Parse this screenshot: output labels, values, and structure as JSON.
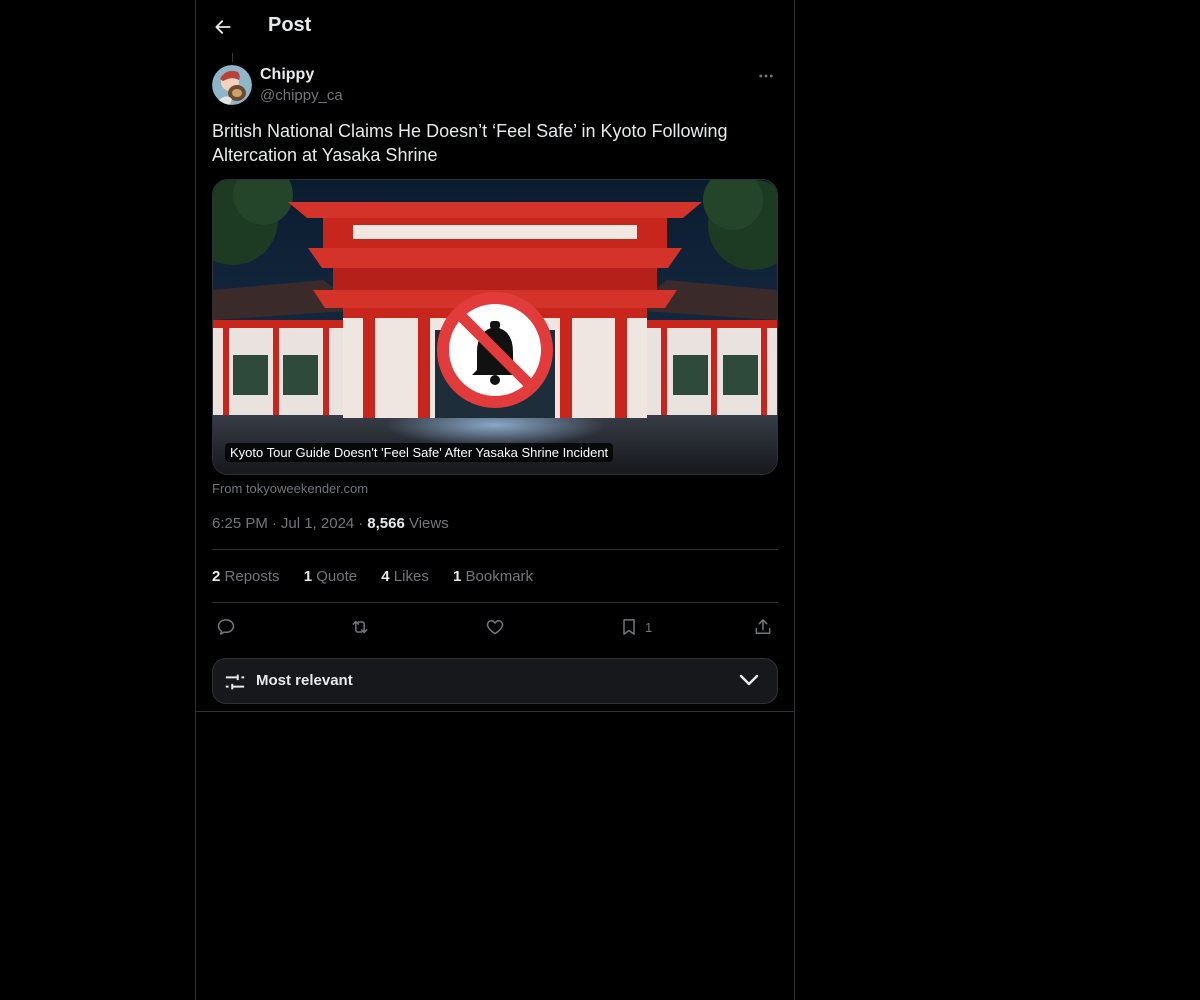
{
  "header": {
    "title": "Post"
  },
  "author": {
    "display_name": "Chippy",
    "handle": "@chippy_ca"
  },
  "post": {
    "text": "British National Claims He Doesn’t ‘Feel Safe’ in Kyoto Following Altercation at Yasaka Shrine"
  },
  "card": {
    "caption": "Kyoto Tour Guide Doesn't 'Feel Safe' After Yasaka Shrine Incident",
    "source": "From tokyoweekender.com"
  },
  "meta": {
    "time": "6:25 PM",
    "separator": "·",
    "date": "Jul 1, 2024",
    "views_count": "8,566",
    "views_label": "Views"
  },
  "stats": {
    "reposts": {
      "count": "2",
      "label": "Reposts"
    },
    "quotes": {
      "count": "1",
      "label": "Quote"
    },
    "likes": {
      "count": "4",
      "label": "Likes"
    },
    "bookmarks": {
      "count": "1",
      "label": "Bookmark"
    }
  },
  "actions": {
    "bookmark_count": "1"
  },
  "sort": {
    "label": "Most relevant"
  },
  "icons": [
    "back-arrow-icon",
    "more-icon",
    "reply-icon",
    "repost-icon",
    "like-icon",
    "bookmark-icon",
    "share-icon",
    "sliders-icon",
    "chevron-down-icon",
    "bell-off-icon"
  ],
  "colors": {
    "background": "#000000",
    "text": "#e7e9ea",
    "secondary_text": "#71767b",
    "border": "#2f3336",
    "shrine_red": "#c8261d"
  }
}
